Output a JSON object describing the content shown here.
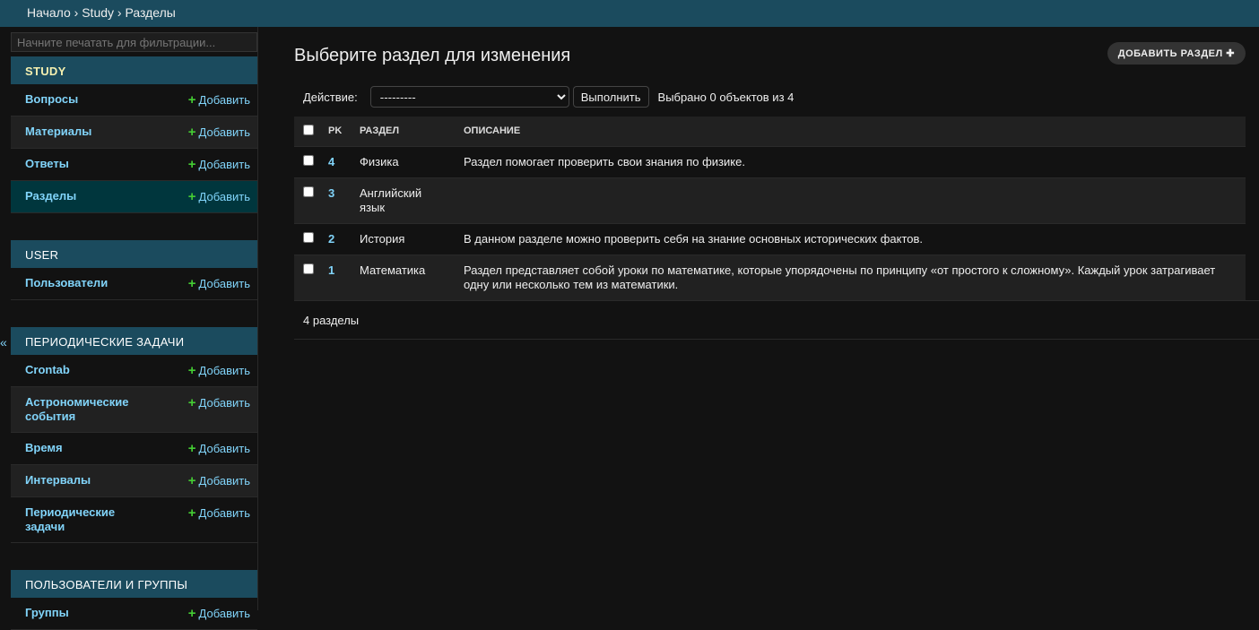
{
  "breadcrumb": "Начало › Study › Разделы",
  "sidebar": {
    "filter_placeholder": "Начните печатать для фильтрации...",
    "toggle": "«",
    "add_label": "Добавить",
    "modules": [
      {
        "caption": "STUDY",
        "items": [
          "Вопросы",
          "Материалы",
          "Ответы",
          "Разделы"
        ],
        "selected": 3
      },
      {
        "caption": "USER",
        "items": [
          "Пользователи"
        ]
      },
      {
        "caption": "ПЕРИОДИЧЕСКИЕ ЗАДАЧИ",
        "items": [
          "Crontab",
          "Астрономические события",
          "Время",
          "Интервалы",
          "Периодические задачи"
        ]
      },
      {
        "caption": "ПОЛЬЗОВАТЕЛИ И ГРУППЫ",
        "items": [
          "Группы"
        ]
      }
    ]
  },
  "main": {
    "title": "Выберите раздел для изменения",
    "add_button": "ДОБАВИТЬ РАЗДЕЛ",
    "action_label": "Действие:",
    "action_value": "---------",
    "go_button": "Выполнить",
    "selected_count": "Выбрано 0 объектов из 4",
    "columns": [
      "PK",
      "РАЗДЕЛ",
      "ОПИСАНИЕ"
    ],
    "rows": [
      {
        "pk": "4",
        "name": "Физика",
        "desc": "Раздел помогает проверить свои знания по физике."
      },
      {
        "pk": "3",
        "name": "Английский язык",
        "desc": ""
      },
      {
        "pk": "2",
        "name": "История",
        "desc": "В данном разделе можно проверить себя на знание основных исторических фактов."
      },
      {
        "pk": "1",
        "name": "Математика",
        "desc": "Раздел представляет собой уроки по математике, которые упорядочены по принципу «от простого к сложному». Каждый урок затрагивает одну или несколько тем из математики."
      }
    ],
    "footer": "4 разделы"
  }
}
